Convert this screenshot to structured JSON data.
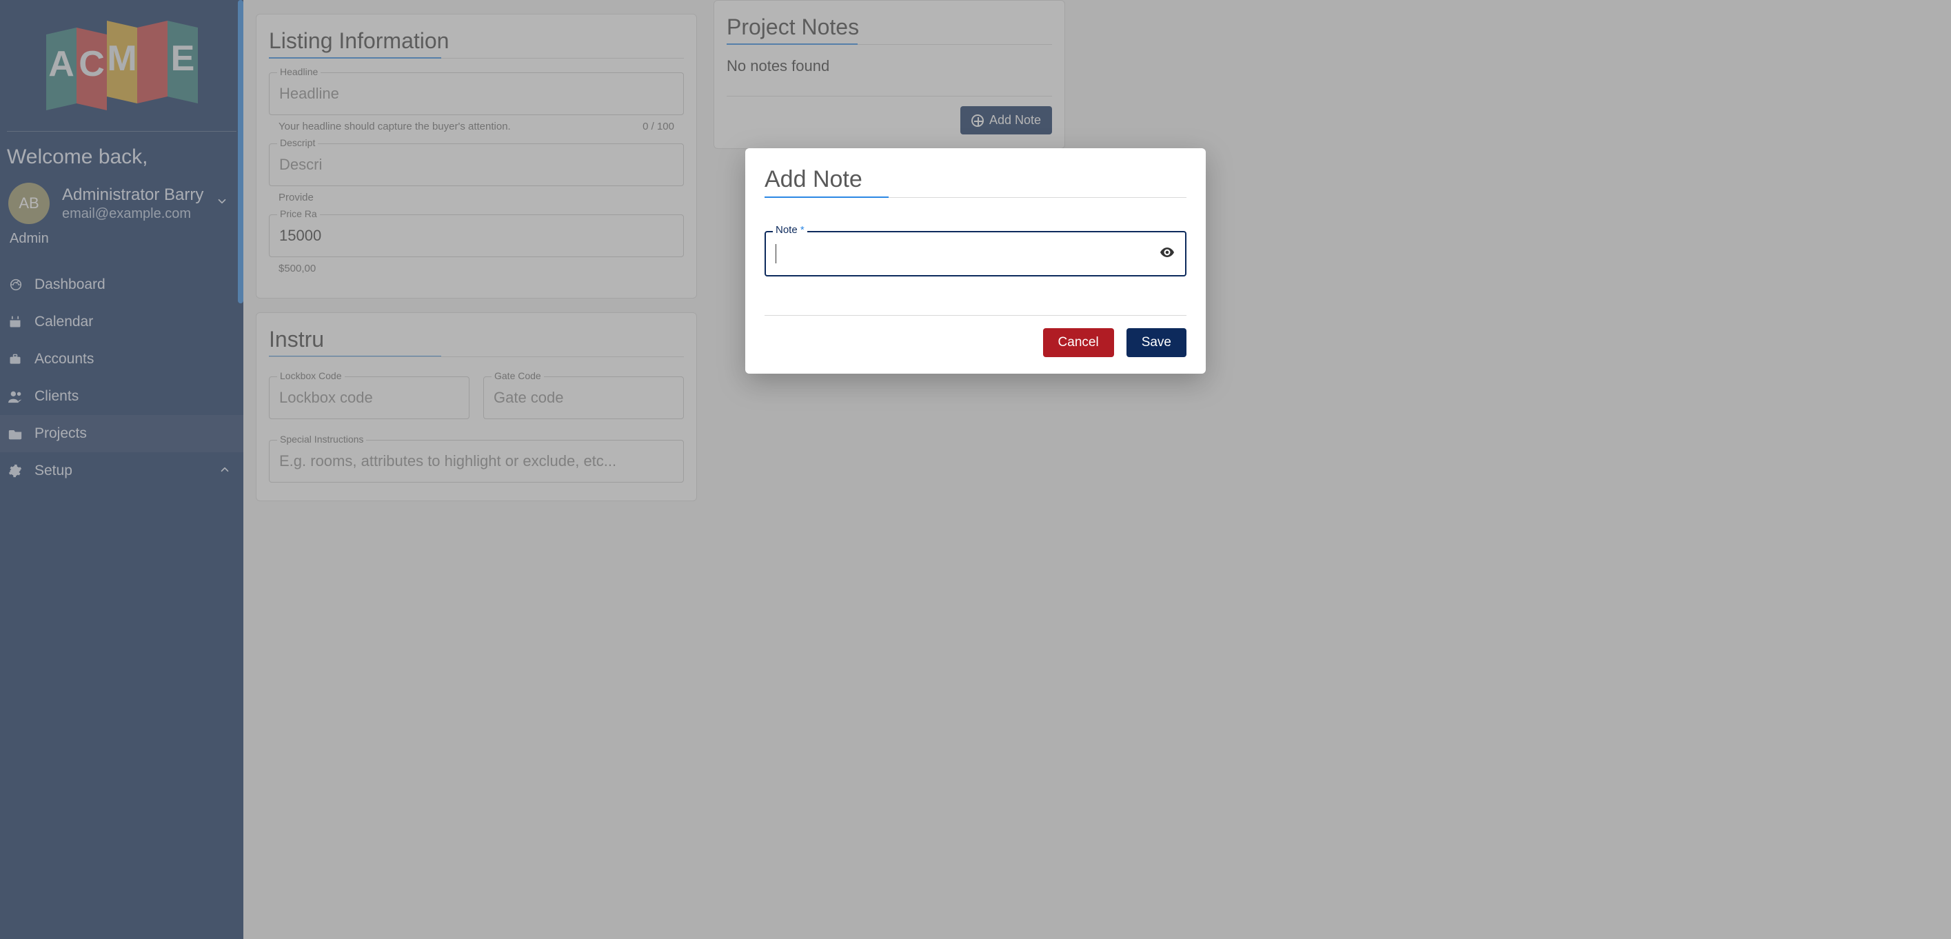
{
  "sidebar": {
    "logo_text": "ACME",
    "welcome": "Welcome back,",
    "avatar_initials": "AB",
    "user_name": "Administrator Barry",
    "user_email": "email@example.com",
    "user_role": "Admin",
    "nav": [
      {
        "icon": "dashboard",
        "label": "Dashboard",
        "active": false,
        "expandable": false
      },
      {
        "icon": "calendar",
        "label": "Calendar",
        "active": false,
        "expandable": false
      },
      {
        "icon": "briefcase",
        "label": "Accounts",
        "active": false,
        "expandable": false
      },
      {
        "icon": "users",
        "label": "Clients",
        "active": false,
        "expandable": false
      },
      {
        "icon": "folder",
        "label": "Projects",
        "active": true,
        "expandable": false
      },
      {
        "icon": "gear",
        "label": "Setup",
        "active": false,
        "expandable": true
      }
    ]
  },
  "listing": {
    "section_title": "Listing Information",
    "headline": {
      "label": "Headline",
      "placeholder": "Headline",
      "value": "",
      "help": "Your headline should capture the buyer's attention.",
      "counter": "0 / 100"
    },
    "description": {
      "label": "Descript",
      "placeholder": "Descri",
      "help": "Provide"
    },
    "price": {
      "label": "Price Ra",
      "value": "15000",
      "help": "$500,00"
    }
  },
  "instructions": {
    "section_title_partial": "Instru",
    "lockbox": {
      "label": "Lockbox Code",
      "placeholder": "Lockbox code"
    },
    "gate": {
      "label": "Gate Code",
      "placeholder": "Gate code"
    },
    "special": {
      "label": "Special Instructions",
      "placeholder": "E.g. rooms, attributes to highlight or exclude, etc..."
    }
  },
  "notes": {
    "title": "Project Notes",
    "empty": "No notes found",
    "add_label": "Add Note"
  },
  "dialog": {
    "title": "Add Note",
    "field_label": "Note",
    "required_mark": "*",
    "value": "",
    "cancel": "Cancel",
    "save": "Save"
  },
  "colors": {
    "brand_navy": "#0d2a5c",
    "accent_blue": "#2b87e4",
    "danger": "#b01c24"
  }
}
